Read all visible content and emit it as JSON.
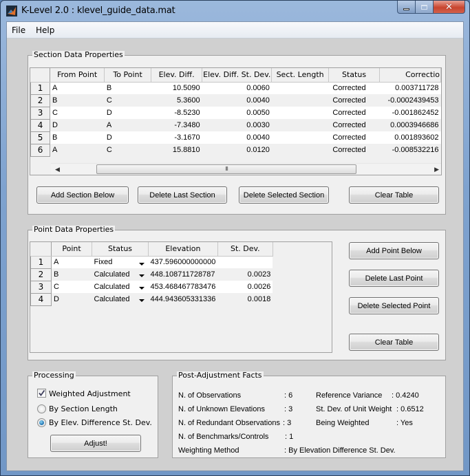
{
  "window": {
    "title": "K-Level 2.0 : klevel_guide_data.mat",
    "icon": "matlab-icon",
    "controls": {
      "minimize": "minimize-icon",
      "maximize": "maximize-icon",
      "close": "close-icon"
    }
  },
  "menu": {
    "items": [
      {
        "label": "File"
      },
      {
        "label": "Help"
      }
    ]
  },
  "section_panel": {
    "title": "Section Data Properties",
    "columns": [
      "From Point",
      "To Point",
      "Elev. Diff.",
      "Elev. Diff. St. Dev.",
      "Sect. Length",
      "Status",
      "Correctio"
    ],
    "rows": [
      {
        "n": "1",
        "from": "A",
        "to": "B",
        "diff": "10.5090",
        "sd": "0.0060",
        "length": "",
        "status": "Corrected",
        "correction": "0.003711728"
      },
      {
        "n": "2",
        "from": "B",
        "to": "C",
        "diff": "5.3600",
        "sd": "0.0040",
        "length": "",
        "status": "Corrected",
        "correction": "-0.0002439453"
      },
      {
        "n": "3",
        "from": "C",
        "to": "D",
        "diff": "-8.5230",
        "sd": "0.0050",
        "length": "",
        "status": "Corrected",
        "correction": "-0.001862452"
      },
      {
        "n": "4",
        "from": "D",
        "to": "A",
        "diff": "-7.3480",
        "sd": "0.0030",
        "length": "",
        "status": "Corrected",
        "correction": "0.0003946686"
      },
      {
        "n": "5",
        "from": "B",
        "to": "D",
        "diff": "-3.1670",
        "sd": "0.0040",
        "length": "",
        "status": "Corrected",
        "correction": "0.001893602"
      },
      {
        "n": "6",
        "from": "A",
        "to": "C",
        "diff": "15.8810",
        "sd": "0.0120",
        "length": "",
        "status": "Corrected",
        "correction": "-0.008532216"
      }
    ],
    "scroll_grip": "III",
    "buttons": {
      "add": "Add Section Below",
      "delete_last": "Delete Last Section",
      "delete_selected": "Delete Selected Section",
      "clear": "Clear Table"
    }
  },
  "point_panel": {
    "title": "Point Data Properties",
    "columns": [
      "Point",
      "Status",
      "Elevation",
      "St. Dev."
    ],
    "rows": [
      {
        "n": "1",
        "point": "A",
        "status": "Fixed",
        "elevation": "437.596000000000",
        "sd": ""
      },
      {
        "n": "2",
        "point": "B",
        "status": "Calculated",
        "elevation": "448.108711728787",
        "sd": "0.0023"
      },
      {
        "n": "3",
        "point": "C",
        "status": "Calculated",
        "elevation": "453.468467783476",
        "sd": "0.0026"
      },
      {
        "n": "4",
        "point": "D",
        "status": "Calculated",
        "elevation": "444.943605331336",
        "sd": "0.0018"
      }
    ],
    "buttons": {
      "add": "Add Point Below",
      "delete_last": "Delete Last Point",
      "delete_selected": "Delete Selected Point",
      "clear": "Clear Table"
    }
  },
  "processing": {
    "title": "Processing",
    "weighted_label": "Weighted Adjustment",
    "weighted_checked": true,
    "radio_length": "By Section Length",
    "radio_sd": "By Elev. Difference St. Dev.",
    "selected": "sd",
    "adjust_button": "Adjust!"
  },
  "facts": {
    "title": "Post-Adjustment Facts",
    "left": [
      {
        "label": "N. of Observations",
        "value": ": 6"
      },
      {
        "label": "N. of Unknown Elevations",
        "value": ": 3"
      },
      {
        "label": "N. of Redundant Observations",
        "value": ": 3"
      },
      {
        "label": "N. of Benchmarks/Controls",
        "value": ": 1"
      }
    ],
    "right": [
      {
        "label": "Reference Variance",
        "value": ": 0.4240"
      },
      {
        "label": "St. Dev. of Unit Weight",
        "value": ": 0.6512"
      },
      {
        "label": "Being Weighted",
        "value": ": Yes"
      }
    ],
    "method_label": "Weighting Method",
    "method_value": ": By Elevation Difference St. Dev."
  }
}
